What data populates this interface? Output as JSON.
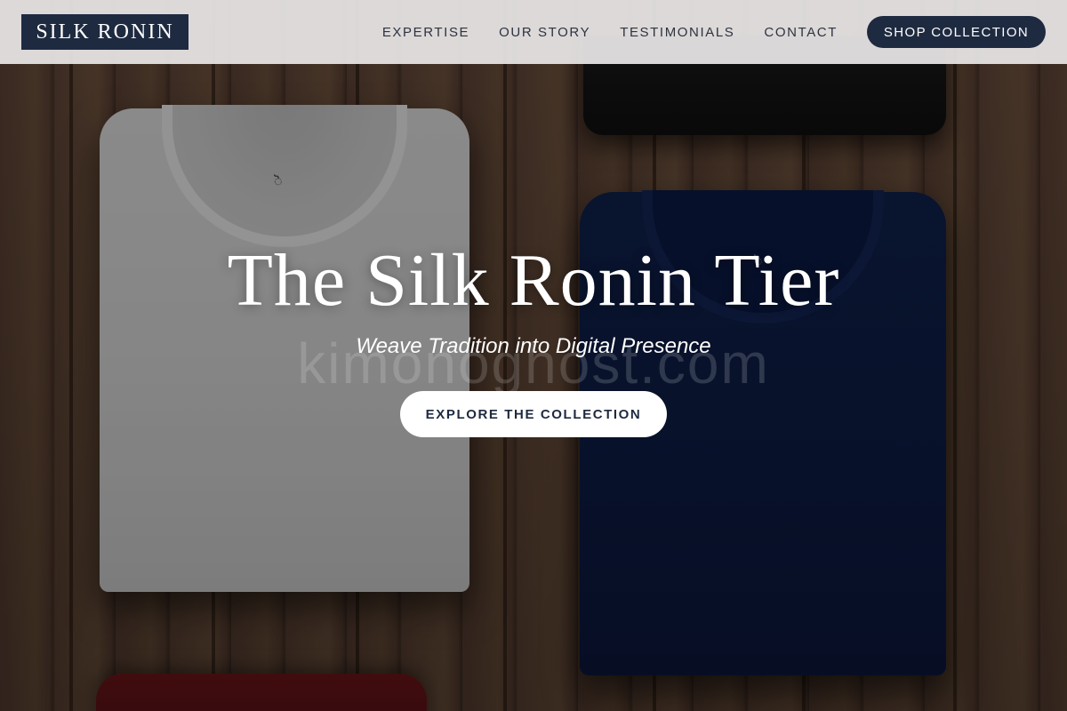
{
  "brand": {
    "logo_text": "SILK RONIN",
    "primary_color": "#1e2a40"
  },
  "nav": {
    "items": [
      {
        "label": "EXPERTISE"
      },
      {
        "label": "OUR STORY"
      },
      {
        "label": "TESTIMONIALS"
      },
      {
        "label": "CONTACT"
      }
    ],
    "cta_label": "SHOP COLLECTION"
  },
  "hero": {
    "title": "The Silk Ronin Tier",
    "subtitle": "Weave Tradition into Digital Presence",
    "cta_label": "EXPLORE THE COLLECTION",
    "watermark": "kimonoghost.com",
    "background_image": "folded-tshirts-on-wood",
    "shirt_tag_glyph": "ॆ"
  }
}
